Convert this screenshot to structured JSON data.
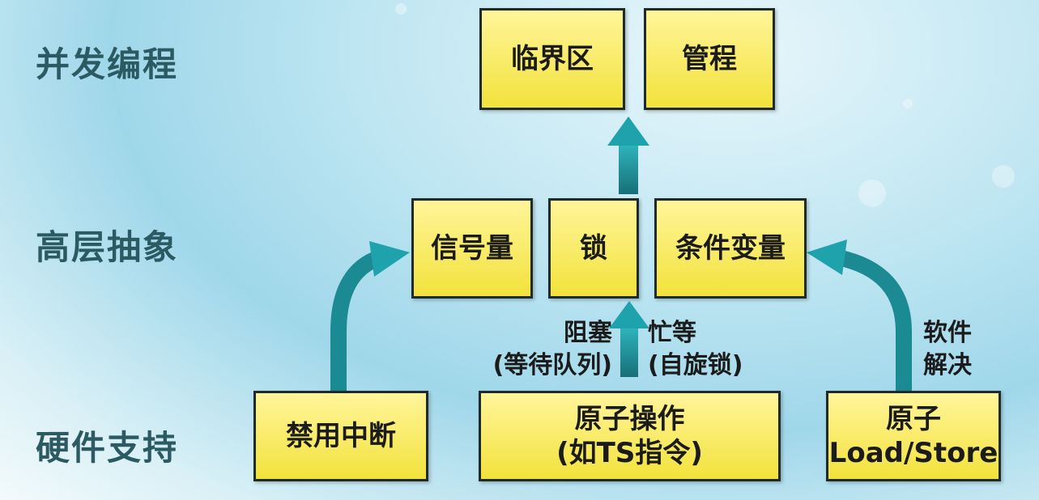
{
  "layers": {
    "concurrency": "并发编程",
    "abstraction": "高层抽象",
    "hardware": "硬件支持"
  },
  "boxes": {
    "critical_section": "临界区",
    "monitor": "管程",
    "semaphore": "信号量",
    "lock": "锁",
    "condition_variable": "条件变量",
    "disable_interrupts": "禁用中断",
    "atomic_op_line1": "原子操作",
    "atomic_op_line2": "(如TS指令)",
    "atomic_ls_line1": "原子",
    "atomic_ls_line2": "Load/Store"
  },
  "notes": {
    "blocking_line1": "阻塞",
    "blocking_line2": "(等待队列)",
    "busy_wait_line1": "忙等",
    "busy_wait_line2": "(自旋锁)",
    "software_line1": "软件",
    "software_line2": "解决"
  },
  "colors": {
    "box_fill": "#f2e23c",
    "arrow": "#1e9aa3",
    "label": "#2b5a63"
  }
}
